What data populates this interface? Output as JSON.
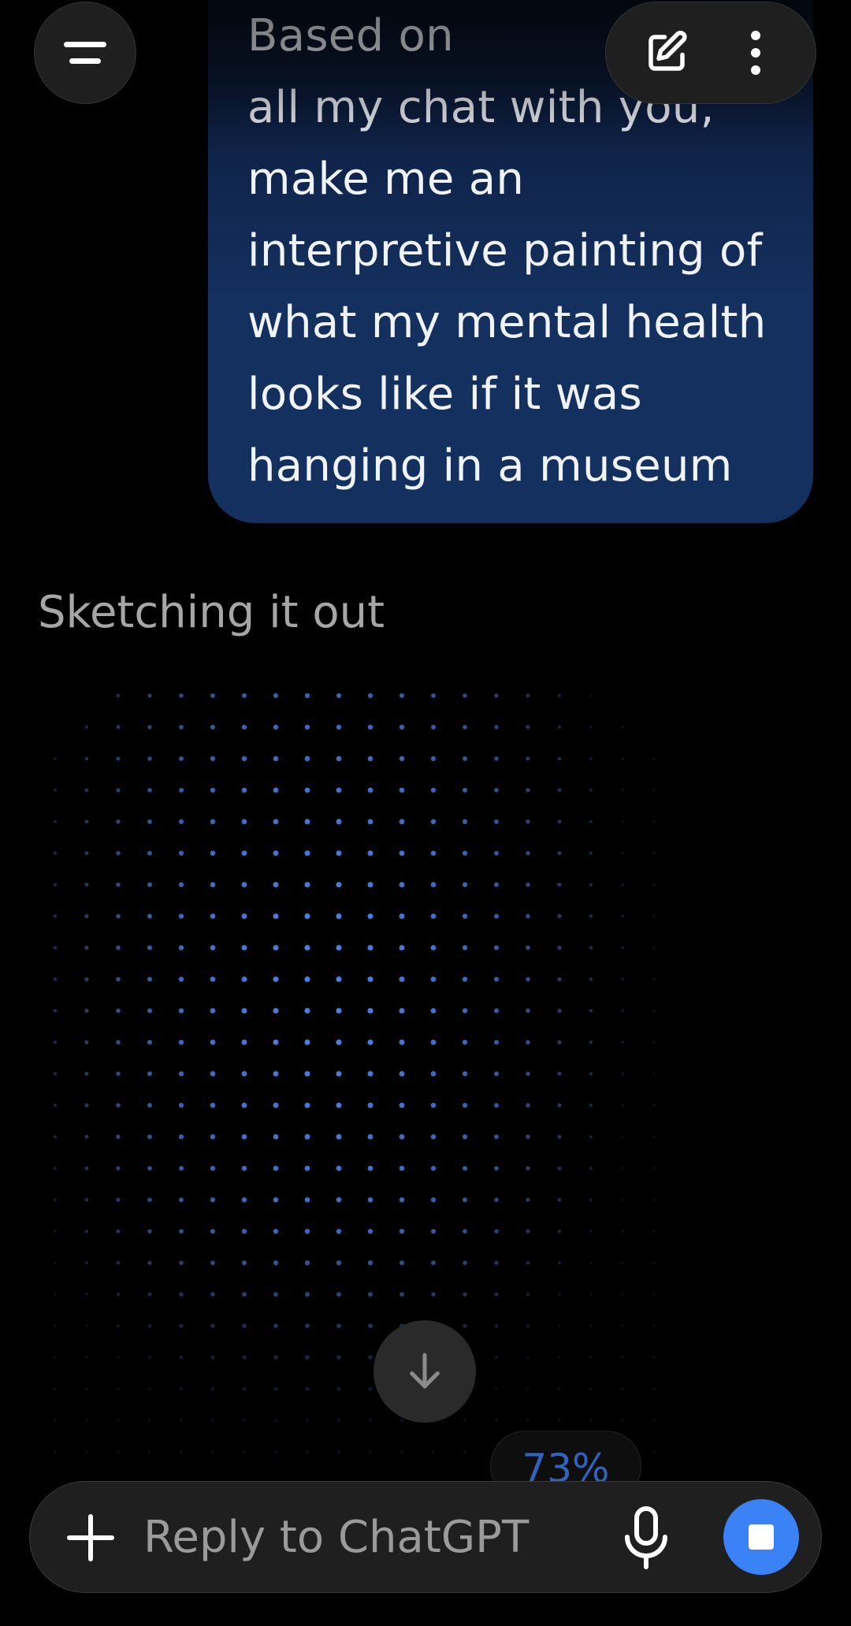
{
  "header": {
    "menu_icon": "menu-icon",
    "new_chat_icon": "edit-icon",
    "more_icon": "more-vertical-icon"
  },
  "message": {
    "user_text": "Based on\nall my chat with you,\nmake me an\ninterpretive painting of\nwhat my mental health\nlooks like if it was\nhanging in a museum"
  },
  "assistant": {
    "status": "Sketching it out",
    "progress_label": "73%",
    "progress_value": 0.73
  },
  "composer": {
    "placeholder": "Reply to ChatGPT",
    "add_icon": "plus-icon",
    "mic_icon": "microphone-icon",
    "stop_icon": "stop-icon"
  },
  "colors": {
    "accent": "#3b82f6",
    "dot": "#4a7fe0",
    "bubble": "#14305e"
  }
}
